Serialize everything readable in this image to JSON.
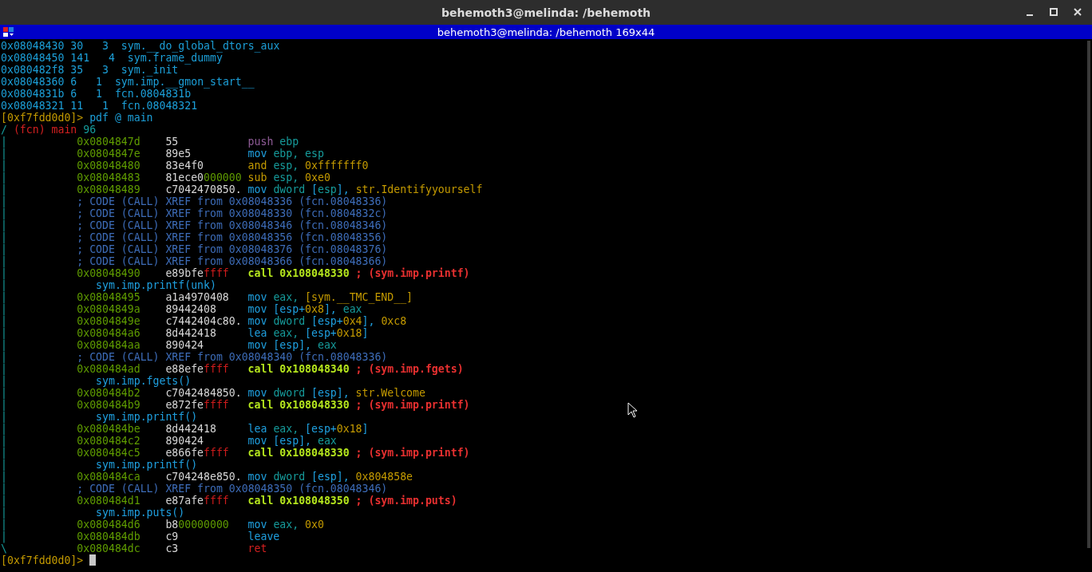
{
  "window": {
    "title": "behemoth3@melinda: /behemoth"
  },
  "terminal": {
    "title": "behemoth3@melinda: /behemoth 169x44",
    "lines": [
      {
        "kind": "plain",
        "segments": [
          {
            "kind": "sym",
            "text": "0x08048430 30   3  sym.__do_global_dtors_aux"
          }
        ]
      },
      {
        "kind": "plain",
        "segments": [
          {
            "kind": "sym",
            "text": "0x08048450 141   4  sym.frame_dummy"
          }
        ]
      },
      {
        "kind": "plain",
        "segments": [
          {
            "kind": "sym",
            "text": "0x080482f8 35   3  sym._init"
          }
        ]
      },
      {
        "kind": "plain",
        "segments": [
          {
            "kind": "sym",
            "text": "0x08048360 6   1  sym.imp.__gmon_start__"
          }
        ]
      },
      {
        "kind": "plain",
        "segments": [
          {
            "kind": "sym",
            "text": "0x0804831b 6   1  fcn.0804831b"
          }
        ]
      },
      {
        "kind": "plain",
        "segments": [
          {
            "kind": "sym",
            "text": "0x08048321 11   1  fcn.08048321"
          }
        ]
      },
      {
        "kind": "plain",
        "segments": [
          {
            "kind": "prompt",
            "text": "[0xf7fdd0d0]>"
          },
          {
            "kind": "sym",
            "text": " pdf @ main"
          }
        ]
      },
      {
        "kind": "plain",
        "segments": [
          {
            "kind": "reg",
            "text": "/"
          },
          {
            "kind": "fcn",
            "text": " (fcn) main"
          },
          {
            "kind": "reg",
            "text": " 96"
          }
        ]
      },
      {
        "kind": "instr",
        "bar": "|",
        "address": "0x0804847d",
        "bytes": [
          {
            "kind": "bytes",
            "text": "55"
          }
        ],
        "asm": [
          {
            "kind": "push",
            "text": "push"
          },
          {
            "kind": "reg",
            "text": " ebp"
          }
        ]
      },
      {
        "kind": "instr",
        "bar": "|",
        "address": "0x0804847e",
        "bytes": [
          {
            "kind": "bytes",
            "text": "89e5"
          }
        ],
        "asm": [
          {
            "kind": "op",
            "text": "mov"
          },
          {
            "kind": "reg",
            "text": " ebp, esp"
          }
        ]
      },
      {
        "kind": "instr",
        "bar": "|",
        "address": "0x08048480",
        "bytes": [
          {
            "kind": "bytes",
            "text": "83e4f0"
          }
        ],
        "asm": [
          {
            "kind": "num",
            "text": "and"
          },
          {
            "kind": "reg",
            "text": " esp,"
          },
          {
            "kind": "num",
            "text": " 0xfffffff0"
          }
        ]
      },
      {
        "kind": "instr",
        "bar": "|",
        "address": "0x08048483",
        "bytes": [
          {
            "kind": "bytes",
            "text": "81ece0"
          },
          {
            "kind": "pad",
            "text": "000000"
          }
        ],
        "asm": [
          {
            "kind": "num",
            "text": "sub"
          },
          {
            "kind": "reg",
            "text": " esp,"
          },
          {
            "kind": "num",
            "text": " 0xe0"
          }
        ]
      },
      {
        "kind": "instr",
        "bar": "|",
        "address": "0x08048489",
        "bytes": [
          {
            "kind": "bytes",
            "text": "c7042470850."
          }
        ],
        "asm": [
          {
            "kind": "op",
            "text": "mov"
          },
          {
            "kind": "reg",
            "text": " dword"
          },
          {
            "kind": "op",
            "text": " ["
          },
          {
            "kind": "reg",
            "text": "esp"
          },
          {
            "kind": "op",
            "text": "],"
          },
          {
            "kind": "num",
            "text": " str.Identifyyourself"
          }
        ]
      },
      {
        "kind": "xref",
        "bar": "|",
        "text": "; CODE (CALL) XREF from 0x08048336 (fcn.08048336)"
      },
      {
        "kind": "xref",
        "bar": "|",
        "text": "; CODE (CALL) XREF from 0x08048330 (fcn.0804832c)"
      },
      {
        "kind": "xref",
        "bar": "|",
        "text": "; CODE (CALL) XREF from 0x08048346 (fcn.08048346)"
      },
      {
        "kind": "xref",
        "bar": "|",
        "text": "; CODE (CALL) XREF from 0x08048356 (fcn.08048356)"
      },
      {
        "kind": "xref",
        "bar": "|",
        "text": "; CODE (CALL) XREF from 0x08048376 (fcn.08048376)"
      },
      {
        "kind": "xref",
        "bar": "|",
        "text": "; CODE (CALL) XREF from 0x08048366 (fcn.08048366)"
      },
      {
        "kind": "instr",
        "bar": "|",
        "address": "0x08048490",
        "bytes": [
          {
            "kind": "bytes",
            "text": "e89bfe"
          },
          {
            "kind": "neg",
            "text": "ffff"
          }
        ],
        "asm": [
          {
            "kind": "call",
            "text": "call 0x108048330"
          },
          {
            "kind": "note",
            "text": " ; (sym.imp.printf)"
          }
        ]
      },
      {
        "kind": "callee",
        "bar": "|",
        "text": "sym.imp.printf(unk)"
      },
      {
        "kind": "instr",
        "bar": "|",
        "address": "0x08048495",
        "bytes": [
          {
            "kind": "bytes",
            "text": "a1a4970408"
          }
        ],
        "asm": [
          {
            "kind": "op",
            "text": "mov"
          },
          {
            "kind": "reg",
            "text": " eax,"
          },
          {
            "kind": "num",
            "text": " [sym.__TMC_END__]"
          }
        ]
      },
      {
        "kind": "instr",
        "bar": "|",
        "address": "0x0804849a",
        "bytes": [
          {
            "kind": "bytes",
            "text": "89442408"
          }
        ],
        "asm": [
          {
            "kind": "op",
            "text": "mov [esp+"
          },
          {
            "kind": "num",
            "text": "0x8"
          },
          {
            "kind": "op",
            "text": "],"
          },
          {
            "kind": "reg",
            "text": " eax"
          }
        ]
      },
      {
        "kind": "instr",
        "bar": "|",
        "address": "0x0804849e",
        "bytes": [
          {
            "kind": "bytes",
            "text": "c7442404c80."
          }
        ],
        "asm": [
          {
            "kind": "op",
            "text": "mov"
          },
          {
            "kind": "reg",
            "text": " dword"
          },
          {
            "kind": "op",
            "text": " [esp+"
          },
          {
            "kind": "num",
            "text": "0x4"
          },
          {
            "kind": "op",
            "text": "],"
          },
          {
            "kind": "num",
            "text": " 0xc8"
          }
        ]
      },
      {
        "kind": "instr",
        "bar": "|",
        "address": "0x080484a6",
        "bytes": [
          {
            "kind": "bytes",
            "text": "8d442418"
          }
        ],
        "asm": [
          {
            "kind": "op",
            "text": "lea"
          },
          {
            "kind": "reg",
            "text": " eax,"
          },
          {
            "kind": "op",
            "text": " [esp+"
          },
          {
            "kind": "num",
            "text": "0x18"
          },
          {
            "kind": "op",
            "text": "]"
          }
        ]
      },
      {
        "kind": "instr",
        "bar": "|",
        "address": "0x080484aa",
        "bytes": [
          {
            "kind": "bytes",
            "text": "890424"
          }
        ],
        "asm": [
          {
            "kind": "op",
            "text": "mov [esp],"
          },
          {
            "kind": "reg",
            "text": " eax"
          }
        ]
      },
      {
        "kind": "xref",
        "bar": "|",
        "text": "; CODE (CALL) XREF from 0x08048340 (fcn.08048336)"
      },
      {
        "kind": "instr",
        "bar": "|",
        "address": "0x080484ad",
        "bytes": [
          {
            "kind": "bytes",
            "text": "e88efe"
          },
          {
            "kind": "neg",
            "text": "ffff"
          }
        ],
        "asm": [
          {
            "kind": "call",
            "text": "call 0x108048340"
          },
          {
            "kind": "note",
            "text": " ; (sym.imp.fgets)"
          }
        ]
      },
      {
        "kind": "callee",
        "bar": "|",
        "text": "sym.imp.fgets()"
      },
      {
        "kind": "instr",
        "bar": "|",
        "address": "0x080484b2",
        "bytes": [
          {
            "kind": "bytes",
            "text": "c7042484850."
          }
        ],
        "asm": [
          {
            "kind": "op",
            "text": "mov"
          },
          {
            "kind": "reg",
            "text": " dword"
          },
          {
            "kind": "op",
            "text": " [esp],"
          },
          {
            "kind": "num",
            "text": " str.Welcome"
          }
        ]
      },
      {
        "kind": "instr",
        "bar": "|",
        "address": "0x080484b9",
        "bytes": [
          {
            "kind": "bytes",
            "text": "e872fe"
          },
          {
            "kind": "neg",
            "text": "ffff"
          }
        ],
        "asm": [
          {
            "kind": "call",
            "text": "call 0x108048330"
          },
          {
            "kind": "note",
            "text": " ; (sym.imp.printf)"
          }
        ]
      },
      {
        "kind": "callee",
        "bar": "|",
        "text": "sym.imp.printf()"
      },
      {
        "kind": "instr",
        "bar": "|",
        "address": "0x080484be",
        "bytes": [
          {
            "kind": "bytes",
            "text": "8d442418"
          }
        ],
        "asm": [
          {
            "kind": "op",
            "text": "lea"
          },
          {
            "kind": "reg",
            "text": " eax,"
          },
          {
            "kind": "op",
            "text": " [esp+"
          },
          {
            "kind": "num",
            "text": "0x18"
          },
          {
            "kind": "op",
            "text": "]"
          }
        ]
      },
      {
        "kind": "instr",
        "bar": "|",
        "address": "0x080484c2",
        "bytes": [
          {
            "kind": "bytes",
            "text": "890424"
          }
        ],
        "asm": [
          {
            "kind": "op",
            "text": "mov [esp],"
          },
          {
            "kind": "reg",
            "text": " eax"
          }
        ]
      },
      {
        "kind": "instr",
        "bar": "|",
        "address": "0x080484c5",
        "bytes": [
          {
            "kind": "bytes",
            "text": "e866fe"
          },
          {
            "kind": "neg",
            "text": "ffff"
          }
        ],
        "asm": [
          {
            "kind": "call",
            "text": "call 0x108048330"
          },
          {
            "kind": "note",
            "text": " ; (sym.imp.printf)"
          }
        ]
      },
      {
        "kind": "callee",
        "bar": "|",
        "text": "sym.imp.printf()"
      },
      {
        "kind": "instr",
        "bar": "|",
        "address": "0x080484ca",
        "bytes": [
          {
            "kind": "bytes",
            "text": "c704248e850."
          }
        ],
        "asm": [
          {
            "kind": "op",
            "text": "mov"
          },
          {
            "kind": "reg",
            "text": " dword"
          },
          {
            "kind": "op",
            "text": " [esp],"
          },
          {
            "kind": "num",
            "text": " 0x804858e"
          }
        ]
      },
      {
        "kind": "xref",
        "bar": "|",
        "text": "; CODE (CALL) XREF from 0x08048350 (fcn.08048346)"
      },
      {
        "kind": "instr",
        "bar": "|",
        "address": "0x080484d1",
        "bytes": [
          {
            "kind": "bytes",
            "text": "e87afe"
          },
          {
            "kind": "neg",
            "text": "ffff"
          }
        ],
        "asm": [
          {
            "kind": "call",
            "text": "call 0x108048350"
          },
          {
            "kind": "note",
            "text": " ; (sym.imp.puts)"
          }
        ]
      },
      {
        "kind": "callee",
        "bar": "|",
        "text": "sym.imp.puts()"
      },
      {
        "kind": "instr",
        "bar": "|",
        "address": "0x080484d6",
        "bytes": [
          {
            "kind": "bytes",
            "text": "b8"
          },
          {
            "kind": "pad",
            "text": "00000000"
          }
        ],
        "asm": [
          {
            "kind": "op",
            "text": "mov"
          },
          {
            "kind": "reg",
            "text": " eax,"
          },
          {
            "kind": "num",
            "text": " 0x0"
          }
        ]
      },
      {
        "kind": "instr",
        "bar": "|",
        "address": "0x080484db",
        "bytes": [
          {
            "kind": "bytes",
            "text": "c9"
          }
        ],
        "asm": [
          {
            "kind": "op",
            "text": "leave"
          }
        ]
      },
      {
        "kind": "instr",
        "bar": "\\",
        "address": "0x080484dc",
        "bytes": [
          {
            "kind": "bytes",
            "text": "c3"
          }
        ],
        "asm": [
          {
            "kind": "ret",
            "text": "ret"
          }
        ]
      },
      {
        "kind": "input",
        "segments": [
          {
            "kind": "prompt",
            "text": "[0xf7fdd0d0]>"
          }
        ]
      }
    ]
  }
}
